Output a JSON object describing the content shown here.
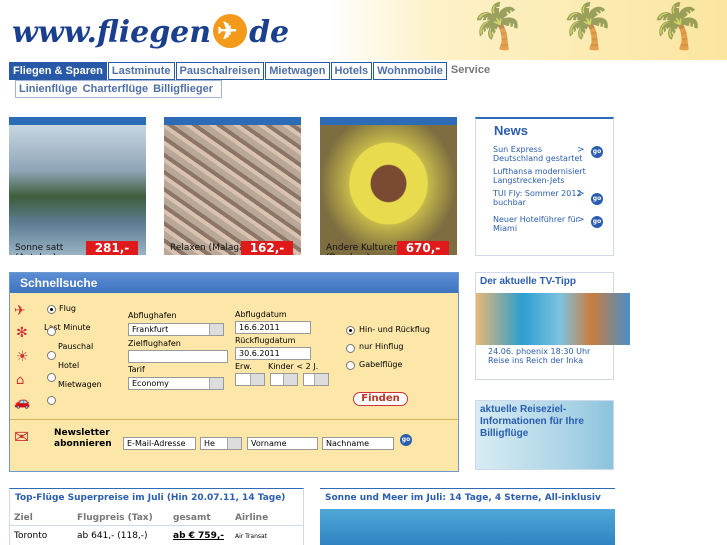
{
  "logo": {
    "pre": "www.fliegen",
    "post": "de"
  },
  "nav": [
    "Fliegen & Sparen",
    "Lastminute",
    "Pauschalreisen",
    "Mietwagen",
    "Hotels",
    "Wohnmobile",
    "Service"
  ],
  "subnav": [
    "Linienflüge",
    "Charterflüge",
    "Billigflieger"
  ],
  "cards": [
    {
      "caption": "Sonne satt (Antalya)",
      "price": "281,-"
    },
    {
      "caption": "Relaxen (Malaga)",
      "price": "162,-"
    },
    {
      "caption": "Andere Kulturen (Bombay)",
      "price": "670,-"
    }
  ],
  "news": {
    "title": "News",
    "items": [
      {
        "text": "Sun Express Deutschland gestartet",
        "arrow": ">"
      },
      {
        "text": "Lufthansa modernisiert Langstrecken-Jets",
        "arrow": ""
      },
      {
        "text": "TUI Fly: Sommer 2012 buchbar",
        "arrow": ">"
      },
      {
        "text": "Neuer Hotelführer für Miami",
        "arrow": ">"
      }
    ],
    "go": "go"
  },
  "quick": {
    "title": "Schnellsuche",
    "types": [
      "Flug",
      "Last Minute",
      "Pauschal",
      "Hotel",
      "Mietwagen"
    ],
    "abflughafen_label": "Abflughafen",
    "abflughafen_value": "Frankfurt",
    "zielflughafen_label": "Zielflughafen",
    "zielflughafen_value": "",
    "tarif_label": "Tarif",
    "tarif_value": "Economy",
    "abflugdatum_label": "Abflugdatum",
    "abflugdatum_value": "16.6.2011",
    "rueckflug_label": "Rückflugdatum",
    "rueckflug_value": "30.6.2011",
    "erw_label": "Erw.",
    "kinder_label": "Kinder < 2 J.",
    "trip": [
      "Hin- und Rückflug",
      "nur Hinflug",
      "Gabelflüge"
    ],
    "finden": "Finden",
    "newsletter": "Newsletter abonnieren",
    "email": "E-Mail-Adresse",
    "anrede": "He",
    "vorname": "Vorname",
    "nachname": "Nachname",
    "go": "go"
  },
  "tv": {
    "title": "Der aktuelle TV-Tipp",
    "caption": "24.06. phoenix 18:30 Uhr Reise ins Reich der Inka"
  },
  "reise": {
    "title": "aktuelle Reiseziel-Informationen für Ihre Billigflüge"
  },
  "top": {
    "title": "Top-Flüge Superpreise im Juli (Hin 20.07.11, 14 Tage)",
    "headers": [
      "Ziel",
      "Flugpreis (Tax)",
      "gesamt",
      "Airline"
    ],
    "rows": [
      [
        "Toronto",
        "ab 641,- (118,-)",
        "ab € 759,-",
        "Air Transat"
      ]
    ]
  },
  "sonne": {
    "title": "Sonne und Meer im Juli: 14 Tage, 4 Sterne, All-inklusiv"
  },
  "colors": {
    "brand": "#2859a8",
    "price": "#e01a1a",
    "accent": "#f39a1a",
    "panel": "#fce6a8"
  }
}
